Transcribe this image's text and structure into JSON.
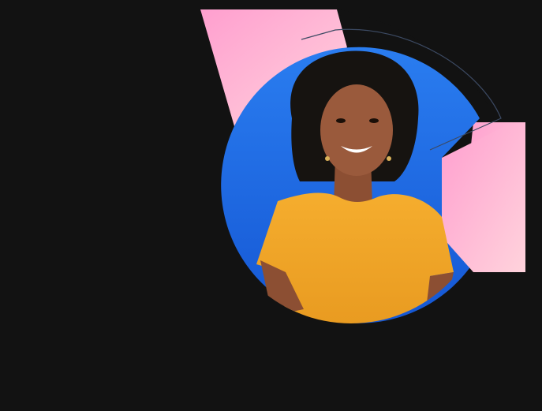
{
  "colors": {
    "background": "#121212",
    "pink": "#ffb3d1",
    "blue": "#1f6fe0",
    "shirt": "#f2a62b",
    "skin": "#9a5a3c",
    "hair": "#161310",
    "outline": "#3c4a63"
  },
  "hero": {
    "subject": "smiling-person-portrait",
    "shapes": [
      "pink-arc-shape",
      "blue-circle-shape",
      "thin-outline-arc"
    ]
  }
}
